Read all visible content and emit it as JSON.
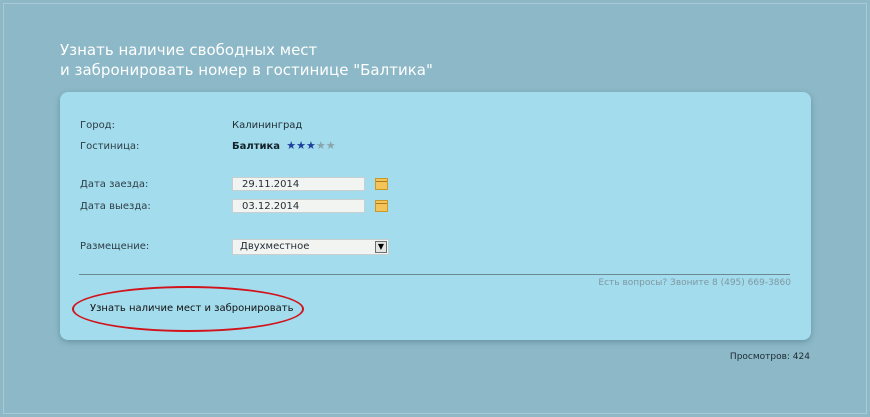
{
  "heading": {
    "line1": "Узнать наличие свободных мест",
    "line2": "и забронировать номер в гостинице \"Балтика\""
  },
  "form": {
    "city_label": "Город:",
    "city_value": "Калининград",
    "hotel_label": "Гостиница:",
    "hotel_value": "Балтика",
    "hotel_stars": 3,
    "hotel_stars_max": 5,
    "checkin_label": "Дата заезда:",
    "checkin_value": "29.11.2014",
    "checkout_label": "Дата выезда:",
    "checkout_value": "03.12.2014",
    "accommodation_label": "Размещение:",
    "accommodation_value": "Двухместное"
  },
  "contact_text": "Есть вопросы? Звоните 8 (495) 669-3860",
  "submit_label": "Узнать наличие мест и забронировать",
  "views_text": "Просмотров: 424",
  "colors": {
    "background": "#8fb8c6",
    "panel": "#a3dcec",
    "star_filled": "#1d3f9e",
    "star_empty": "#8aa3ad",
    "highlight": "#d1141c"
  },
  "icons": [
    "calendar-icon",
    "chevron-down-icon",
    "star-icon"
  ]
}
